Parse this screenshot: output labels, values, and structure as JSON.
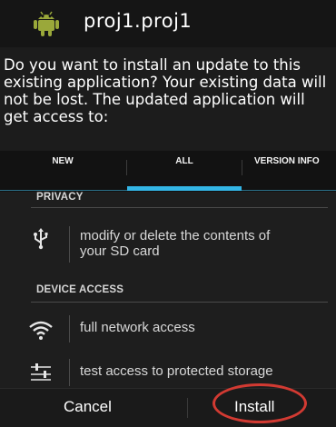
{
  "header": {
    "app_icon": "android-robot-icon",
    "title": "proj1.proj1"
  },
  "message": "Do you want to install an update to this existing application? Your existing data will not be lost. The updated application will get access to:",
  "tabs": [
    {
      "label": "NEW",
      "selected": false
    },
    {
      "label": "ALL",
      "selected": true
    },
    {
      "label": "VERSION INFO",
      "selected": false
    }
  ],
  "permissions": {
    "privacy": {
      "header": "PRIVACY",
      "items": [
        {
          "icon": "usb-icon",
          "text_line1": "modify or delete the contents of",
          "text_line2": "your SD card"
        }
      ]
    },
    "device_access": {
      "header": "DEVICE ACCESS",
      "items": [
        {
          "icon": "wifi-icon",
          "text": "full network access"
        },
        {
          "icon": "settings-sliders-icon",
          "text": "test access to protected storage"
        }
      ]
    }
  },
  "buttons": {
    "cancel": "Cancel",
    "install": "Install"
  },
  "colors": {
    "accent": "#33b5e5",
    "annotation": "#d23a32"
  }
}
